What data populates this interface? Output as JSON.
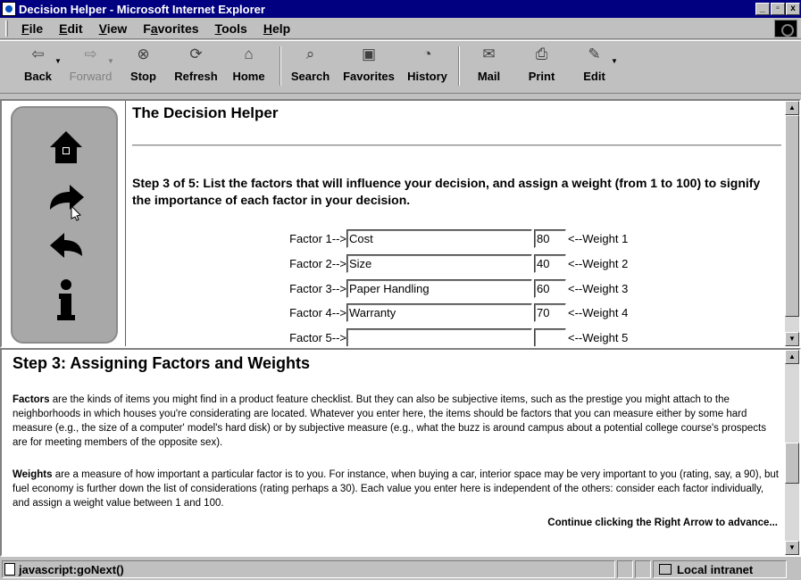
{
  "window": {
    "title": "Decision Helper - Microsoft Internet Explorer",
    "controls": [
      "_",
      "▫",
      "x"
    ]
  },
  "menu": [
    {
      "key": "F",
      "rest": "ile"
    },
    {
      "key": "E",
      "rest": "dit"
    },
    {
      "key": "V",
      "rest": "iew"
    },
    {
      "pre": "F",
      "key": "a",
      "rest": "vorites"
    },
    {
      "key": "T",
      "rest": "ools"
    },
    {
      "key": "H",
      "rest": "elp"
    }
  ],
  "toolbar": {
    "back": "Back",
    "forward": "Forward",
    "stop": "Stop",
    "refresh": "Refresh",
    "home": "Home",
    "search": "Search",
    "favorites": "Favorites",
    "history": "History",
    "mail": "Mail",
    "print": "Print",
    "edit": "Edit"
  },
  "top": {
    "title": "The Decision Helper",
    "step_text": "Step 3 of 5: List the factors that will influence your decision, and assign a weight (from 1 to 100) to signify the importance of each factor in your decision.",
    "factors": [
      {
        "label": "Factor 1-->",
        "name": "Cost",
        "weight": "80",
        "weight_label": "<--Weight 1"
      },
      {
        "label": "Factor 2-->",
        "name": "Size",
        "weight": "40",
        "weight_label": "<--Weight 2"
      },
      {
        "label": "Factor 3-->",
        "name": "Paper Handling",
        "weight": "60",
        "weight_label": "<--Weight 3"
      },
      {
        "label": "Factor 4-->",
        "name": "Warranty",
        "weight": "70",
        "weight_label": "<--Weight 4"
      },
      {
        "label": "Factor 5-->",
        "name": "",
        "weight": "",
        "weight_label": "<--Weight 5"
      }
    ]
  },
  "bottom": {
    "title": "Step 3: Assigning Factors and Weights",
    "factors_term": "Factors",
    "factors_text": " are the kinds of items you might find in a product feature checklist. But they can also be subjective items, such as the prestige you might attach to the neighborhoods in which houses you're considerating are located. Whatever you enter here, the items should be factors that you can measure either by some hard measure (e.g., the size of a computer' model's hard disk) or by subjective measure (e.g., what the buzz is around campus about a potential college course's prospects are for meeting members of the opposite sex).",
    "weights_term": "Weights",
    "weights_text": " are a measure of how important a particular factor is to you. For instance, when buying a car, interior space may be very important to you (rating, say, a 90), but fuel economy is further down the list of considerations (rating perhaps a 30). Each value you enter here is independent of the others: consider each factor individually, and assign a weight value between 1 and 100.",
    "continue": "Continue clicking the Right Arrow to advance..."
  },
  "status": {
    "text": "javascript:goNext()",
    "zone": "Local intranet"
  }
}
